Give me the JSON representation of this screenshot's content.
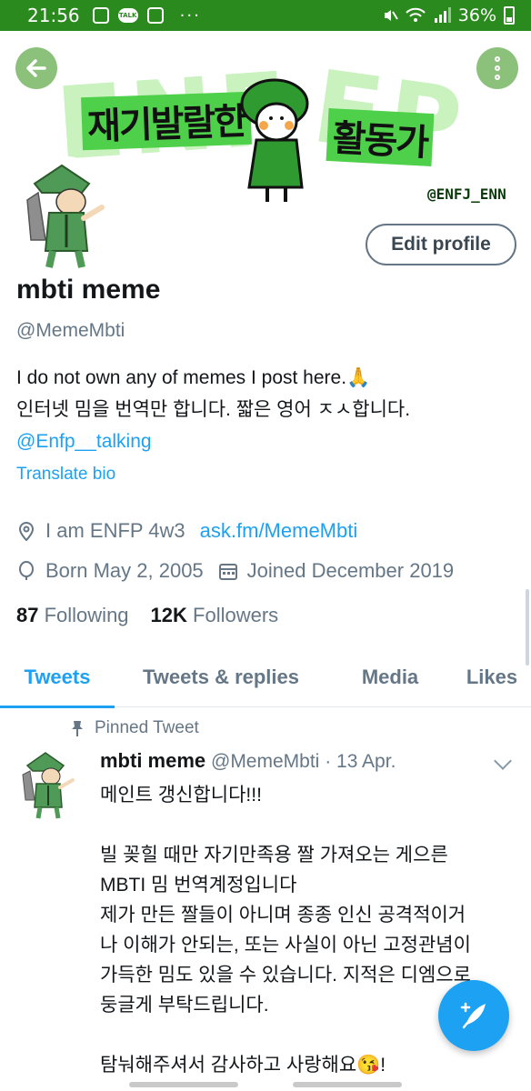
{
  "status_bar": {
    "time": "21:56",
    "battery": "36%",
    "dots": "···",
    "talk": "TALK"
  },
  "header": {
    "banner_left_text": "재기발랄한",
    "banner_right_text": "활동가",
    "banner_bg_left": "ENF",
    "banner_bg_right": "FP",
    "banner_handle": "@ENFJ_ENN",
    "back_icon": "←"
  },
  "profile": {
    "edit_label": "Edit profile",
    "display_name": "mbti meme",
    "handle": "@MemeMbti",
    "bio_line1": "I do not own any of memes I post here.🙏",
    "bio_line2": "인터넷 밈을 번역만 합니다. 짧은 영어 ㅈㅅ합니다.",
    "bio_link": "@Enfp__talking",
    "translate": "Translate bio",
    "location": "I am ENFP 4w3",
    "website": "ask.fm/MemeMbti",
    "born": "Born May 2, 2005",
    "joined": "Joined December 2019",
    "following_count": "87",
    "following_label": "Following",
    "followers_count": "12K",
    "followers_label": "Followers"
  },
  "tabs": [
    {
      "label": "Tweets",
      "active": true
    },
    {
      "label": "Tweets & replies",
      "active": false
    },
    {
      "label": "Media",
      "active": false
    },
    {
      "label": "Likes",
      "active": false
    }
  ],
  "tweet": {
    "pinned_label": "Pinned Tweet",
    "name": "mbti meme",
    "handle": "@MemeMbti",
    "date": "· 13 Apr.",
    "lines": [
      "메인트 갱신합니다!!!",
      "",
      "빌 꽂힐 때만 자기만족용 짤 가져오는 게으른",
      "MBTI 밈 번역계정입니다",
      "제가 만든 짤들이 아니며 종종 인신 공격적이거",
      "나 이해가 안되는, 또는 사실이 아닌 고정관념이",
      "가득한 밈도 있을 수 있습니다. 지적은 디엠으로",
      "둥글게 부탁드립니다.",
      "",
      "탐눠해주셔서 감사하고 사랑해요😘!"
    ]
  },
  "colors": {
    "status_bar": "#2b8a1e",
    "accent": "#1da1f2",
    "banner_green": "#4fd04a",
    "button_green": "#8cc17c"
  },
  "icons": [
    "back-arrow-icon",
    "more-vertical-icon",
    "location-icon",
    "birthday-icon",
    "calendar-icon",
    "pin-icon",
    "chevron-down-icon",
    "compose-tweet-icon"
  ]
}
